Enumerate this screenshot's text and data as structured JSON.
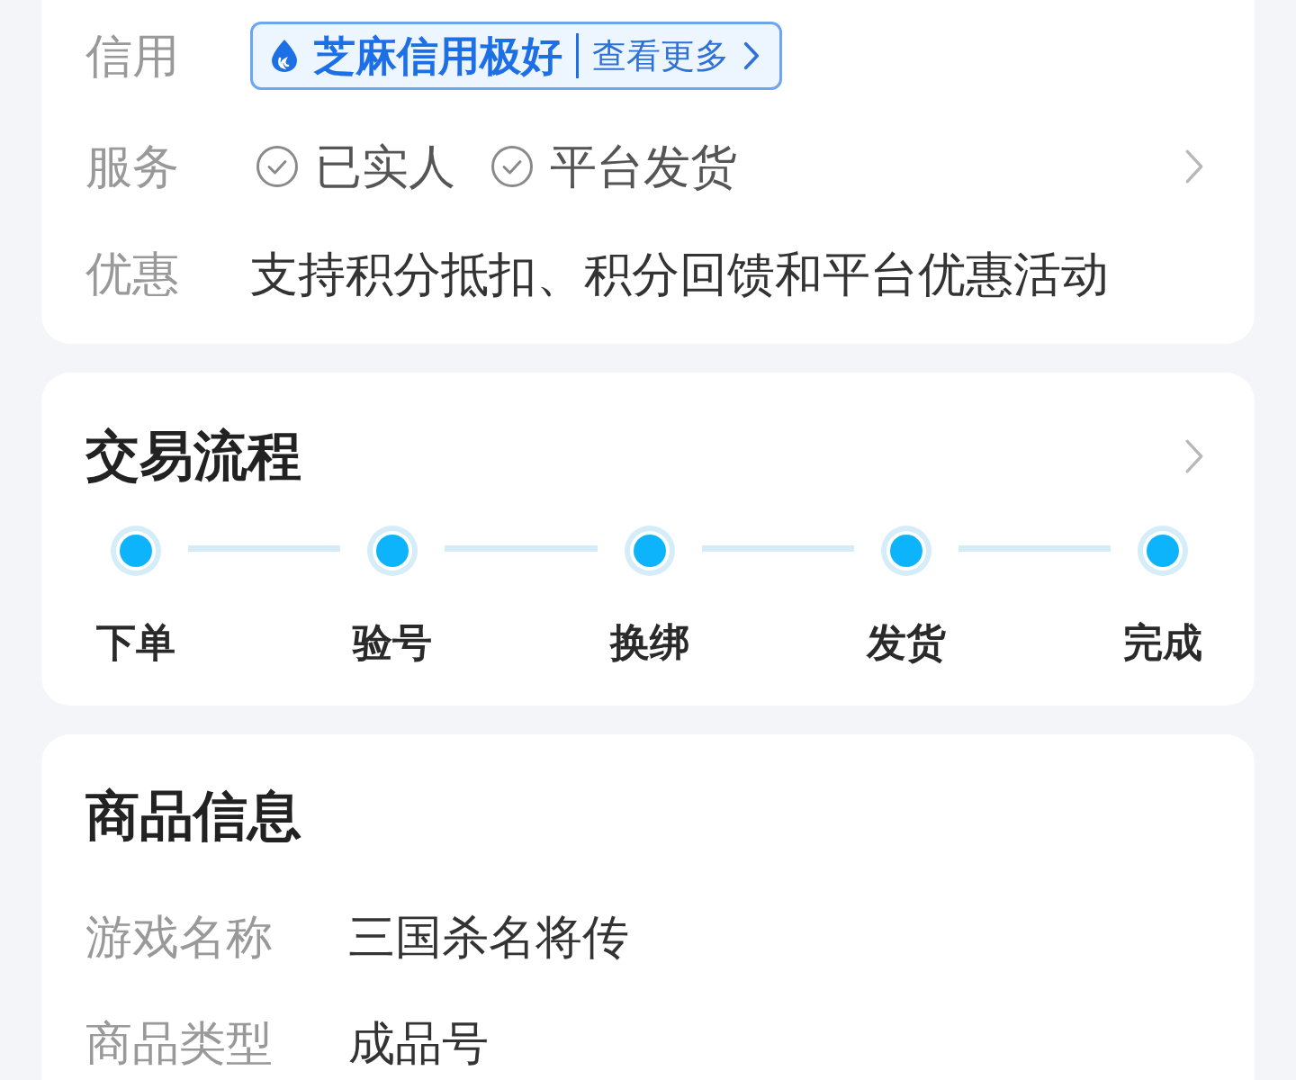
{
  "info_card": {
    "credit": {
      "label": "信用",
      "badge": {
        "title": "芝麻信用极好",
        "link": "查看更多"
      }
    },
    "services": {
      "label": "服务",
      "items": [
        "已实人",
        "平台发货"
      ]
    },
    "discount": {
      "label": "优惠",
      "value": "支持积分抵扣、积分回馈和平台优惠活动"
    }
  },
  "process_card": {
    "title": "交易流程",
    "steps": [
      "下单",
      "验号",
      "换绑",
      "发货",
      "完成"
    ]
  },
  "product_card": {
    "title": "商品信息",
    "rows": [
      {
        "label": "游戏名称",
        "value": "三国杀名将传"
      },
      {
        "label": "商品类型",
        "value": "成品号"
      }
    ]
  }
}
